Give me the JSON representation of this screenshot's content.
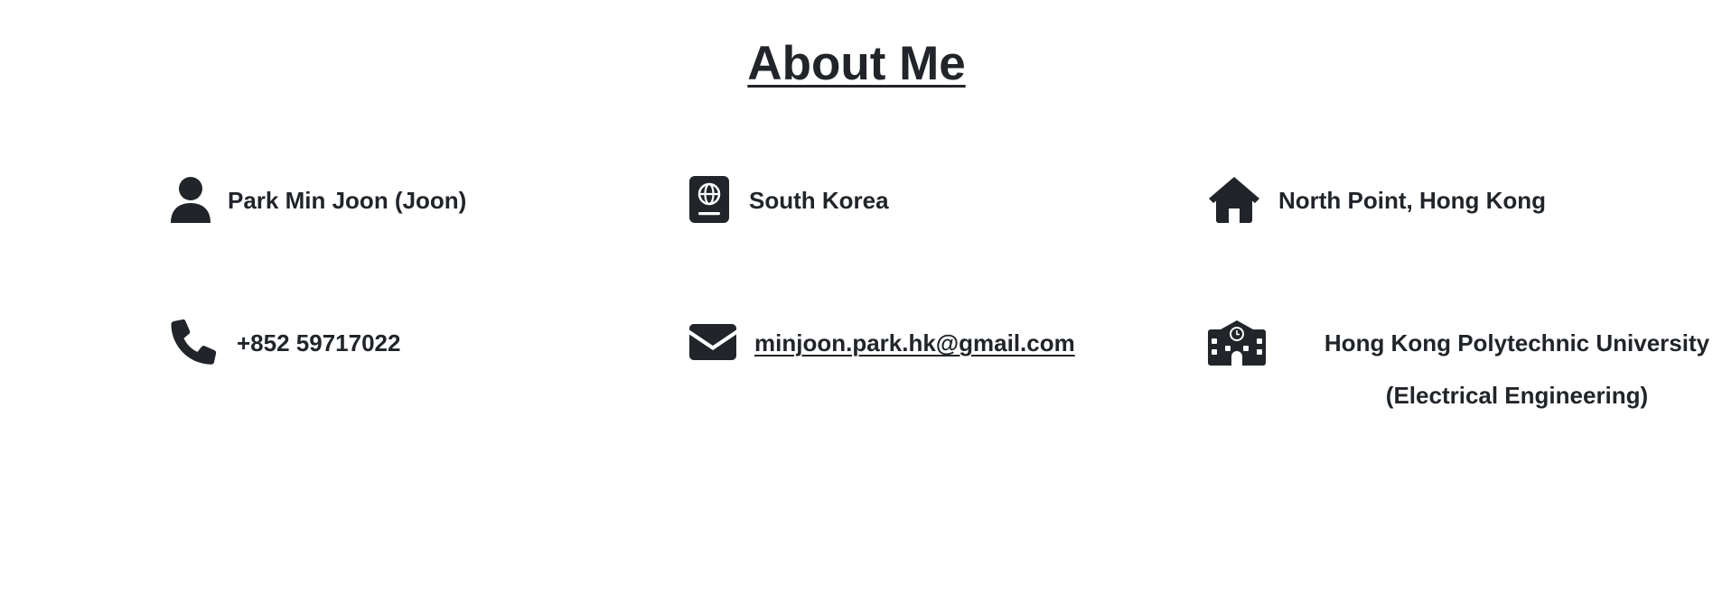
{
  "page": {
    "title": "About Me"
  },
  "about": {
    "name": "Park Min Joon (Joon)",
    "nationality": "South Korea",
    "address": "North Point, Hong Kong",
    "phone": "+852 59717022",
    "email": "minjoon.park.hk@gmail.com",
    "school": "Hong Kong Polytechnic University (Electrical Engineering)"
  },
  "icons": {
    "name": "person-icon",
    "nationality": "passport-icon",
    "address": "house-icon",
    "phone": "phone-icon",
    "email": "envelope-icon",
    "school": "school-icon"
  },
  "colors": {
    "text": "#212529",
    "background": "#ffffff"
  }
}
